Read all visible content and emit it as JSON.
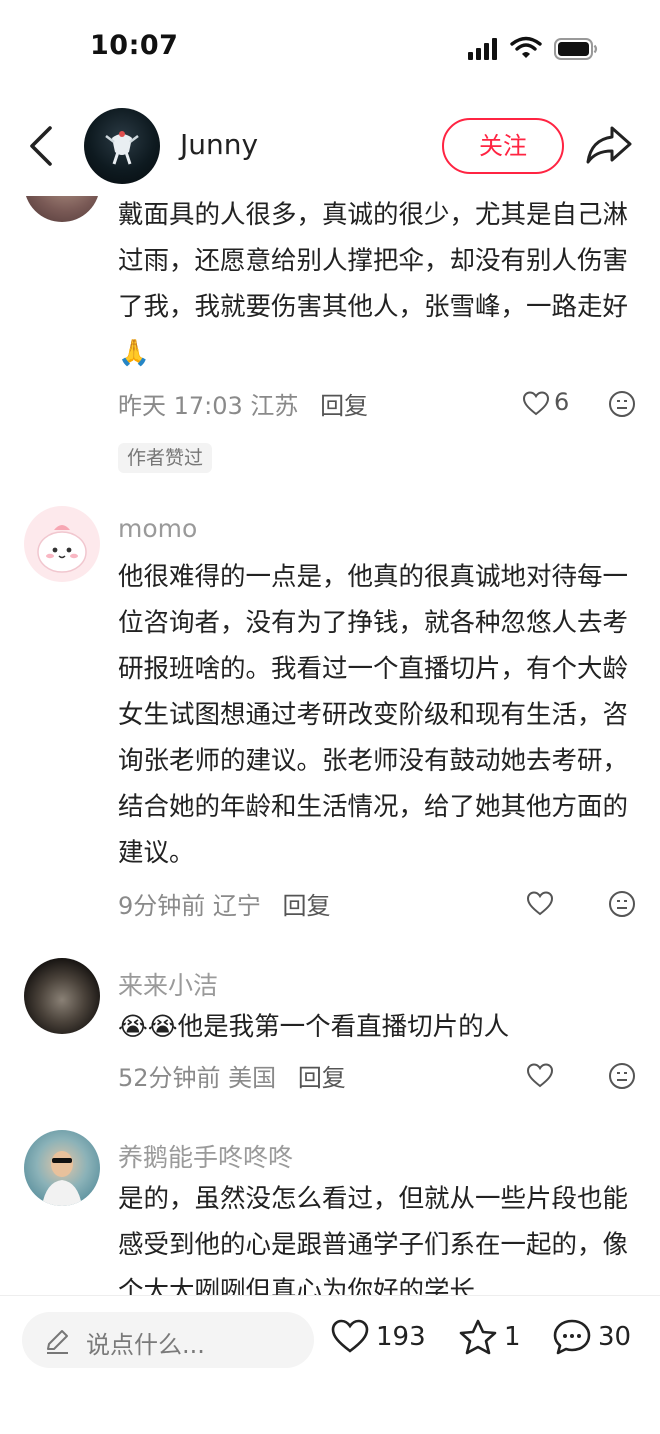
{
  "status_bar": {
    "time": "10:07"
  },
  "header": {
    "author_name": "Junny",
    "follow_label": "关注"
  },
  "comments": [
    {
      "text": "戴面具的人很多，真诚的很少，尤其是自己淋过雨，还愿意给别人撑把伞，却没有别人伤害了我，我就要伤害其他人，张雪峰，一路走好🙏",
      "time_location": "昨天 17:03 江苏",
      "reply_label": "回复",
      "likes": "6",
      "tag": "作者赞过"
    },
    {
      "username": "momo",
      "text": "他很难得的一点是，他真的很真诚地对待每一位咨询者，没有为了挣钱，就各种忽悠人去考研报班啥的。我看过一个直播切片，有个大龄女生试图想通过考研改变阶级和现有生活，咨询张老师的建议。张老师没有鼓动她去考研，结合她的年龄和生活情况，给了她其他方面的建议。",
      "time_location": "9分钟前 辽宁",
      "reply_label": "回复"
    },
    {
      "username": "来来小洁",
      "text": "😭😭他是我第一个看直播切片的人",
      "time_location": "52分钟前 美国",
      "reply_label": "回复"
    },
    {
      "username": "养鹅能手咚咚咚",
      "text": "是的，虽然没怎么看过，但就从一些片段也能感受到他的心是跟普通学子们系在一起的，像个大大咧咧但真心为你好的学长"
    }
  ],
  "bottom_bar": {
    "input_placeholder": "说点什么...",
    "like_count": "193",
    "collect_count": "1",
    "comment_count": "30"
  },
  "icons": {
    "back": "chevron-left-icon",
    "share": "share-arrow-icon",
    "like": "heart-icon",
    "dislike": "neutral-face-icon",
    "collect": "star-icon",
    "comment": "chat-bubble-icon",
    "edit": "pencil-icon"
  },
  "colors": {
    "accent": "#ff2442"
  }
}
